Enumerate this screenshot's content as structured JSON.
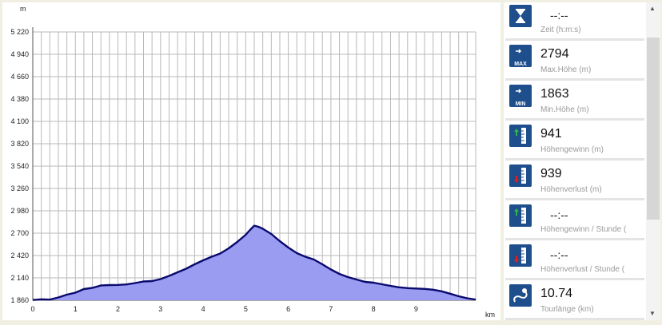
{
  "chart_data": {
    "type": "area",
    "ylabel": "m",
    "xlabel": "km",
    "ylim": [
      1860,
      5220
    ],
    "xlim": [
      0,
      10.4
    ],
    "y_ticks": [
      "5 220",
      "4 940",
      "4 660",
      "4 380",
      "4 100",
      "3 820",
      "3 540",
      "3 260",
      "2 980",
      "2 700",
      "2 420",
      "2 140",
      "1 860"
    ],
    "y_tick_values": [
      5220,
      4940,
      4660,
      4380,
      4100,
      3820,
      3540,
      3260,
      2980,
      2700,
      2420,
      2140,
      1860
    ],
    "x_ticks": [
      "0",
      "1",
      "2",
      "3",
      "4",
      "5",
      "6",
      "7",
      "8",
      "9"
    ],
    "x_tick_values": [
      0,
      1,
      2,
      3,
      4,
      5,
      6,
      7,
      8,
      9
    ],
    "grid": true,
    "fill_color": "#9a9cf2",
    "line_color": "#0a0a6e",
    "series": [
      {
        "x": [
          0,
          0.2,
          0.4,
          0.6,
          0.8,
          1.0,
          1.2,
          1.4,
          1.6,
          1.8,
          2.0,
          2.2,
          2.4,
          2.6,
          2.8,
          3.0,
          3.2,
          3.4,
          3.6,
          3.8,
          4.0,
          4.2,
          4.4,
          4.6,
          4.8,
          5.0,
          5.1,
          5.2,
          5.3,
          5.4,
          5.6,
          5.8,
          6.0,
          6.2,
          6.4,
          6.6,
          6.8,
          7.0,
          7.2,
          7.4,
          7.6,
          7.8,
          8.0,
          8.2,
          8.4,
          8.6,
          8.8,
          9.0,
          9.2,
          9.4,
          9.6,
          9.8,
          10.0,
          10.2,
          10.4
        ],
        "y": [
          1863,
          1872,
          1868,
          1895,
          1930,
          1955,
          2000,
          2015,
          2045,
          2050,
          2052,
          2058,
          2075,
          2095,
          2100,
          2125,
          2165,
          2210,
          2255,
          2310,
          2360,
          2405,
          2445,
          2510,
          2590,
          2680,
          2740,
          2794,
          2780,
          2755,
          2690,
          2600,
          2520,
          2450,
          2405,
          2370,
          2310,
          2245,
          2190,
          2150,
          2120,
          2090,
          2080,
          2060,
          2040,
          2022,
          2012,
          2007,
          2002,
          1992,
          1972,
          1942,
          1910,
          1885,
          1868
        ]
      }
    ]
  },
  "stats": [
    {
      "icon": "hourglass-icon",
      "value": "--:--",
      "label": "Zeit (h:m:s)",
      "dim": true
    },
    {
      "icon": "max-height-icon",
      "value": "2794",
      "label": "Max.Höhe (m)",
      "dim": false,
      "badge": "MAX"
    },
    {
      "icon": "min-height-icon",
      "value": "1863",
      "label": "Min.Höhe (m)",
      "dim": false,
      "badge": "MIN"
    },
    {
      "icon": "elevation-gain-icon",
      "value": "941",
      "label": "Höhengewinn (m)",
      "dim": false
    },
    {
      "icon": "elevation-loss-icon",
      "value": "939",
      "label": "Höhenverlust (m)",
      "dim": false
    },
    {
      "icon": "gain-per-hour-icon",
      "value": "--:--",
      "label": "Höhengewinn / Stunde (",
      "dim": true
    },
    {
      "icon": "loss-per-hour-icon",
      "value": "--:--",
      "label": "Höhenverlust / Stunde (",
      "dim": true
    },
    {
      "icon": "tour-length-icon",
      "value": "10.74",
      "label": "Tourlänge (km)",
      "dim": false
    }
  ]
}
